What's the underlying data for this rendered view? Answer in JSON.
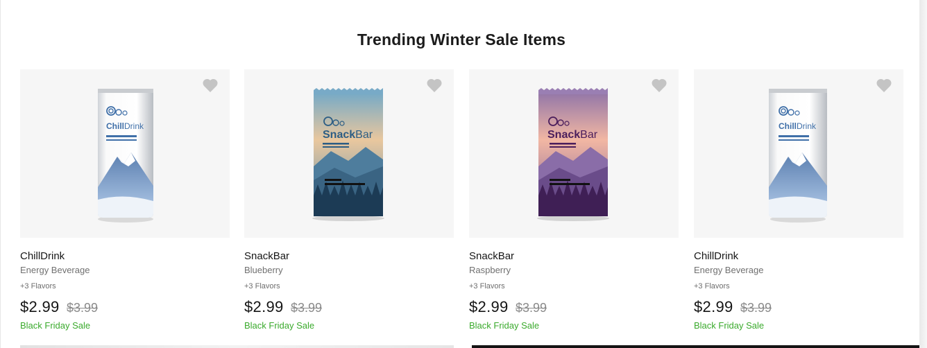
{
  "section": {
    "title": "Trending Winter Sale Items"
  },
  "products": [
    {
      "name": "ChillDrink",
      "subtitle": "Energy Beverage",
      "flavors": "+3 Flavors",
      "price": "$2.99",
      "old_price": "$3.99",
      "promo": "Black Friday Sale",
      "kind": "can",
      "brand": "ChillDrink"
    },
    {
      "name": "SnackBar",
      "subtitle": "Blueberry",
      "flavors": "+3 Flavors",
      "price": "$2.99",
      "old_price": "$3.99",
      "promo": "Black Friday Sale",
      "kind": "bar",
      "brand_a": "Snack",
      "brand_b": "Bar",
      "theme": "blueberry"
    },
    {
      "name": "SnackBar",
      "subtitle": "Raspberry",
      "flavors": "+3 Flavors",
      "price": "$2.99",
      "old_price": "$3.99",
      "promo": "Black Friday Sale",
      "kind": "bar",
      "brand_a": "Snack",
      "brand_b": "Bar",
      "theme": "raspberry"
    },
    {
      "name": "ChillDrink",
      "subtitle": "Energy Beverage",
      "flavors": "+3 Flavors",
      "price": "$2.99",
      "old_price": "$3.99",
      "promo": "Black Friday Sale",
      "kind": "can",
      "brand": "ChillDrink"
    }
  ],
  "colors": {
    "sale_green": "#3aaa2c",
    "heart_gray": "#c4c4c4",
    "card_bg": "#f6f6f6"
  },
  "icons": {
    "favorite": "heart-icon"
  }
}
